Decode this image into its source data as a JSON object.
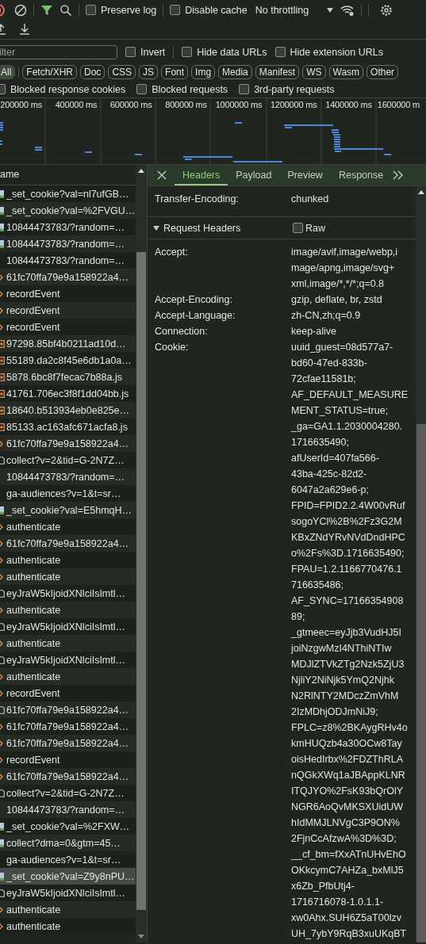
{
  "toolbar": {
    "recording": true,
    "checkboxes": [
      {
        "label": "Preserve log",
        "checked": false
      },
      {
        "label": "Disable cache",
        "checked": false
      }
    ],
    "throttling": "No throttling"
  },
  "filter_bar": {
    "placeholder": "ilter",
    "options": [
      {
        "label": "Invert",
        "checked": false
      },
      {
        "label": "Hide data URLs",
        "checked": false
      },
      {
        "label": "Hide extension URLs",
        "checked": false
      }
    ]
  },
  "type_filters": [
    {
      "label": "All",
      "selected": true
    },
    {
      "label": "Fetch/XHR",
      "selected": false
    },
    {
      "label": "Doc",
      "selected": false
    },
    {
      "label": "CSS",
      "selected": false
    },
    {
      "label": "JS",
      "selected": false
    },
    {
      "label": "Font",
      "selected": false
    },
    {
      "label": "Img",
      "selected": false
    },
    {
      "label": "Media",
      "selected": false
    },
    {
      "label": "Manifest",
      "selected": false
    },
    {
      "label": "WS",
      "selected": false
    },
    {
      "label": "Wasm",
      "selected": false
    },
    {
      "label": "Other",
      "selected": false
    }
  ],
  "more_filters": [
    {
      "label": "Blocked response cookies",
      "checked": false
    },
    {
      "label": "Blocked requests",
      "checked": false
    },
    {
      "label": "3rd-party requests",
      "checked": false
    }
  ],
  "timeline": {
    "ticks": [
      "200000 ms",
      "400000 ms",
      "600000 ms",
      "800000 ms",
      "1000000 ms",
      "1200000 ms",
      "1400000 ms",
      "1600000 m"
    ]
  },
  "requests": {
    "column": "ame",
    "rows": [
      {
        "name": "_set_cookie?val=nl7ufGB…",
        "kind": "img",
        "selected": false
      },
      {
        "name": "_set_cookie?val=%2FVGU…",
        "kind": "img",
        "selected": false
      },
      {
        "name": "10844473783/?random=…",
        "kind": "img",
        "selected": false
      },
      {
        "name": "10844473783/?random=…",
        "kind": "img",
        "selected": false
      },
      {
        "name": "10844473783/?random=…",
        "kind": "other",
        "selected": false
      },
      {
        "name": "61fc70ffa79e9a158922a4…",
        "kind": "xhr",
        "selected": false
      },
      {
        "name": "recordEvent",
        "kind": "xhr",
        "selected": false
      },
      {
        "name": "recordEvent",
        "kind": "xhr",
        "selected": false
      },
      {
        "name": "recordEvent",
        "kind": "xhr",
        "selected": false
      },
      {
        "name": "97298.85bf4b0211ad10d…",
        "kind": "js",
        "selected": false
      },
      {
        "name": "55189.da2c8f45e6db1a0a…",
        "kind": "js",
        "selected": false
      },
      {
        "name": "5878.6bc8f7fecac7b88a.js",
        "kind": "js",
        "selected": false
      },
      {
        "name": "41761.706ec3f8f1dd04bb.js",
        "kind": "js",
        "selected": false
      },
      {
        "name": "18640.b513934eb0e825e…",
        "kind": "js",
        "selected": false
      },
      {
        "name": "85133.ac163afc671acfa8.js",
        "kind": "js",
        "selected": false
      },
      {
        "name": "61fc70ffa79e9a158922a4…",
        "kind": "xhr",
        "selected": false
      },
      {
        "name": "collect?v=2&tid=G-2N7Z…",
        "kind": "doc",
        "selected": false
      },
      {
        "name": "10844473783/?random=…",
        "kind": "other",
        "selected": false
      },
      {
        "name": "ga-audiences?v=1&t=sr…",
        "kind": "other",
        "selected": false
      },
      {
        "name": "_set_cookie?val=E5hmqH…",
        "kind": "img",
        "selected": false
      },
      {
        "name": "authenticate",
        "kind": "xhr",
        "selected": false
      },
      {
        "name": "61fc70ffa79e9a158922a4…",
        "kind": "xhr",
        "selected": false
      },
      {
        "name": "authenticate",
        "kind": "xhr",
        "selected": false
      },
      {
        "name": "authenticate",
        "kind": "xhr",
        "selected": false
      },
      {
        "name": "eyJraW5kIjoidXNlciIsImtl…",
        "kind": "doc",
        "selected": false
      },
      {
        "name": "authenticate",
        "kind": "xhr",
        "selected": false
      },
      {
        "name": "eyJraW5kIjoidXNlciIsImtl…",
        "kind": "doc",
        "selected": false
      },
      {
        "name": "authenticate",
        "kind": "xhr",
        "selected": false
      },
      {
        "name": "eyJraW5kIjoidXNlciIsImtl…",
        "kind": "doc",
        "selected": false
      },
      {
        "name": "authenticate",
        "kind": "xhr",
        "selected": false
      },
      {
        "name": "recordEvent",
        "kind": "xhr",
        "selected": false
      },
      {
        "name": "61fc70ffa79e9a158922a4…",
        "kind": "doc",
        "selected": false
      },
      {
        "name": "61fc70ffa79e9a158922a4…",
        "kind": "xhr",
        "selected": false
      },
      {
        "name": "61fc70ffa79e9a158922a4…",
        "kind": "xhr",
        "selected": false
      },
      {
        "name": "recordEvent",
        "kind": "xhr",
        "selected": false
      },
      {
        "name": "61fc70ffa79e9a158922a4…",
        "kind": "xhr",
        "selected": false
      },
      {
        "name": "collect?v=2&tid=G-2N7Z…",
        "kind": "doc",
        "selected": false
      },
      {
        "name": "10844473783/?random=…",
        "kind": "other",
        "selected": false
      },
      {
        "name": "_set_cookie?val=%2FXW…",
        "kind": "img",
        "selected": false
      },
      {
        "name": "collect?dma=0&gtm=45…",
        "kind": "img",
        "selected": false
      },
      {
        "name": "ga-audiences?v=1&t=sr…",
        "kind": "other",
        "selected": false
      },
      {
        "name": "_set_cookie?val=Z9y8nPU…",
        "kind": "img",
        "selected": true
      },
      {
        "name": "eyJraW5kIjoidXNlciIsImtl…",
        "kind": "doc",
        "selected": false
      },
      {
        "name": "authenticate",
        "kind": "xhr",
        "selected": false
      },
      {
        "name": "authenticate",
        "kind": "xhr",
        "selected": false
      }
    ]
  },
  "details": {
    "tabs": [
      {
        "label": "Headers",
        "selected": true
      },
      {
        "label": "Payload",
        "selected": false
      },
      {
        "label": "Preview",
        "selected": false
      },
      {
        "label": "Response",
        "selected": false
      }
    ],
    "response_headers": [
      {
        "name": "Transfer-Encoding:",
        "value": [
          "chunked"
        ]
      }
    ],
    "request_headers": {
      "title": "Request Headers",
      "expanded": true,
      "raw": {
        "label": "Raw",
        "checked": false
      },
      "rows": [
        {
          "name": "Accept:",
          "value": [
            "image/avif,image/webp,i",
            "mage/apng,image/svg+",
            "xml,image/*,*/*;q=0.8"
          ]
        },
        {
          "name": "Accept-Encoding:",
          "value": [
            "gzip, deflate, br, zstd"
          ]
        },
        {
          "name": "Accept-Language:",
          "value": [
            "zh-CN,zh;q=0.9"
          ]
        },
        {
          "name": "Connection:",
          "value": [
            "keep-alive"
          ]
        },
        {
          "name": "Cookie:",
          "value": [
            "uuid_guest=08d577a7-",
            "bd60-47ed-833b-",
            "72cfae11581b;",
            "AF_DEFAULT_MEASURE",
            "MENT_STATUS=true;",
            "_ga=GA1.1.2030004280.",
            "1716635490;",
            "afUserId=407fa566-",
            "43ba-425c-82d2-",
            "6047a2a629e6-p;",
            "FPID=FPID2.2.4W00vRuf",
            "sogoYCl%2B%2Fz3G2M",
            "KBxZNdYRvNVdDndHPC",
            "o%2Fs%3D.1716635490;",
            "FPAU=1.2.1166770476.1",
            "716635486;",
            "AF_SYNC=17166354908",
            "89;",
            "_gtmeec=eyJjb3VudHJ5I",
            "joiNzgwMzI4NThiNTIw",
            "MDJlZTVkZTg2Nzk5ZjU3",
            "NjliY2NiNjk5YmQ2Njhk",
            "N2RlNTY2MDczZmVhM",
            "2IzMDhjODJmNiJ9;",
            "FPLC=z8%2BKAygRHv4o",
            "kmHUQzb4a30OCw8Tay",
            "oisHedIrbx%2FDZThRLA",
            "nQGkXWq1aJBAppKLNR",
            "ITQJYO%2FsK93bQrOlY",
            "NGR6AoQvMKSXUidUW",
            "hIdMMJLNVgC3P9ON%",
            "2FjnCcAfzwA%3D%3D;",
            "__cf_bm=fXxATnUHvEhO",
            "OKkcymC7AHZa_bxMlJ5",
            "x6Zb_PfbUtj4-",
            "1716716078-1.0.1.1-",
            "xw0Ahx.SUH6Z5aT00lzv",
            "UH_7ybY9RqB3xuUKqBT"
          ]
        }
      ]
    }
  }
}
